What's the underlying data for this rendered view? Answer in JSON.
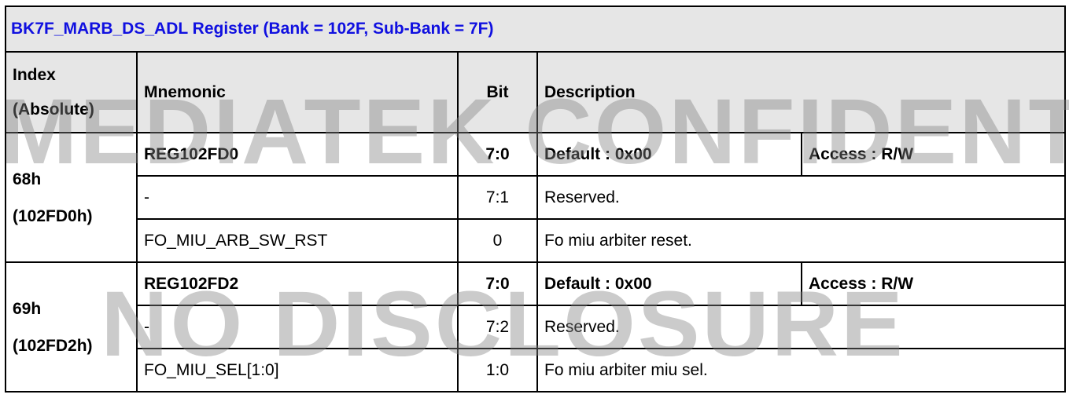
{
  "title": "BK7F_MARB_DS_ADL Register (Bank = 102F, Sub-Bank = 7F)",
  "headers": {
    "index_line1": "Index",
    "index_line2": "(Absolute)",
    "mnemonic": "Mnemonic",
    "bit": "Bit",
    "description": "Description"
  },
  "registers": [
    {
      "index": "68h",
      "absolute": "(102FD0h)",
      "name": "REG102FD0",
      "bit": "7:0",
      "default": "Default : 0x00",
      "access": "Access : R/W",
      "fields": [
        {
          "mnemonic": "-",
          "bit": "7:1",
          "description": "Reserved."
        },
        {
          "mnemonic": "FO_MIU_ARB_SW_RST",
          "bit": "0",
          "description": "Fo miu arbiter reset."
        }
      ]
    },
    {
      "index": "69h",
      "absolute": "(102FD2h)",
      "name": "REG102FD2",
      "bit": "7:0",
      "default": "Default : 0x00",
      "access": "Access : R/W",
      "fields": [
        {
          "mnemonic": "-",
          "bit": "7:2",
          "description": "Reserved."
        },
        {
          "mnemonic": "FO_MIU_SEL[1:0]",
          "bit": "1:0",
          "description": "Fo miu arbiter miu sel."
        }
      ]
    }
  ],
  "watermark": {
    "line1": "MEDIATEK CONFIDENTIAL",
    "line2": "NO DISCLOSURE"
  }
}
